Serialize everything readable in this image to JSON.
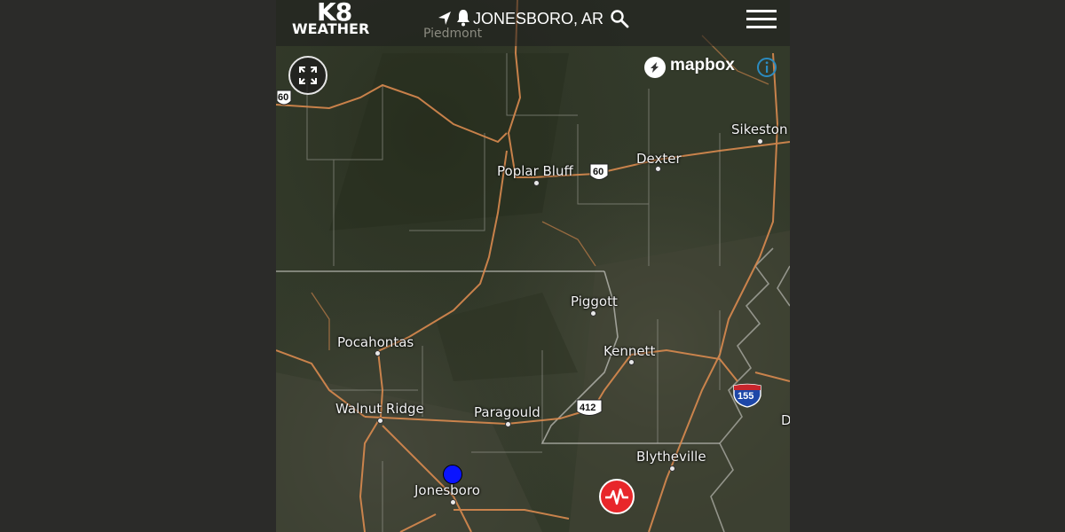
{
  "header": {
    "logo_top": "K8",
    "logo_bottom": "WEATHER",
    "location": "JONESBORO, AR",
    "icons": [
      "navigation-arrow-icon",
      "bell-icon",
      "search-icon",
      "hamburger-menu-icon"
    ]
  },
  "map": {
    "attribution": "mapbox",
    "cities": {
      "piedmont": "Piedmont",
      "sikeston": "Sikeston",
      "poplar_bluff": "Poplar Bluff",
      "dexter": "Dexter",
      "piggott": "Piggott",
      "pocahontas": "Pocahontas",
      "kennett": "Kennett",
      "walnut_ridge": "Walnut Ridge",
      "paragould": "Paragould",
      "blytheville": "Blytheville",
      "jonesboro": "Jonesboro",
      "edge_d": "D"
    },
    "highways": {
      "us60_left": "60",
      "us60_right": "60",
      "us412": "412",
      "i155": "155"
    },
    "markers": {
      "current_location_color": "#0a14ff",
      "earthquake_color": "#e8262a"
    }
  },
  "colors": {
    "road": "#d98a4f",
    "border": "#a8a8a0",
    "page_bg": "#2b2b29"
  }
}
